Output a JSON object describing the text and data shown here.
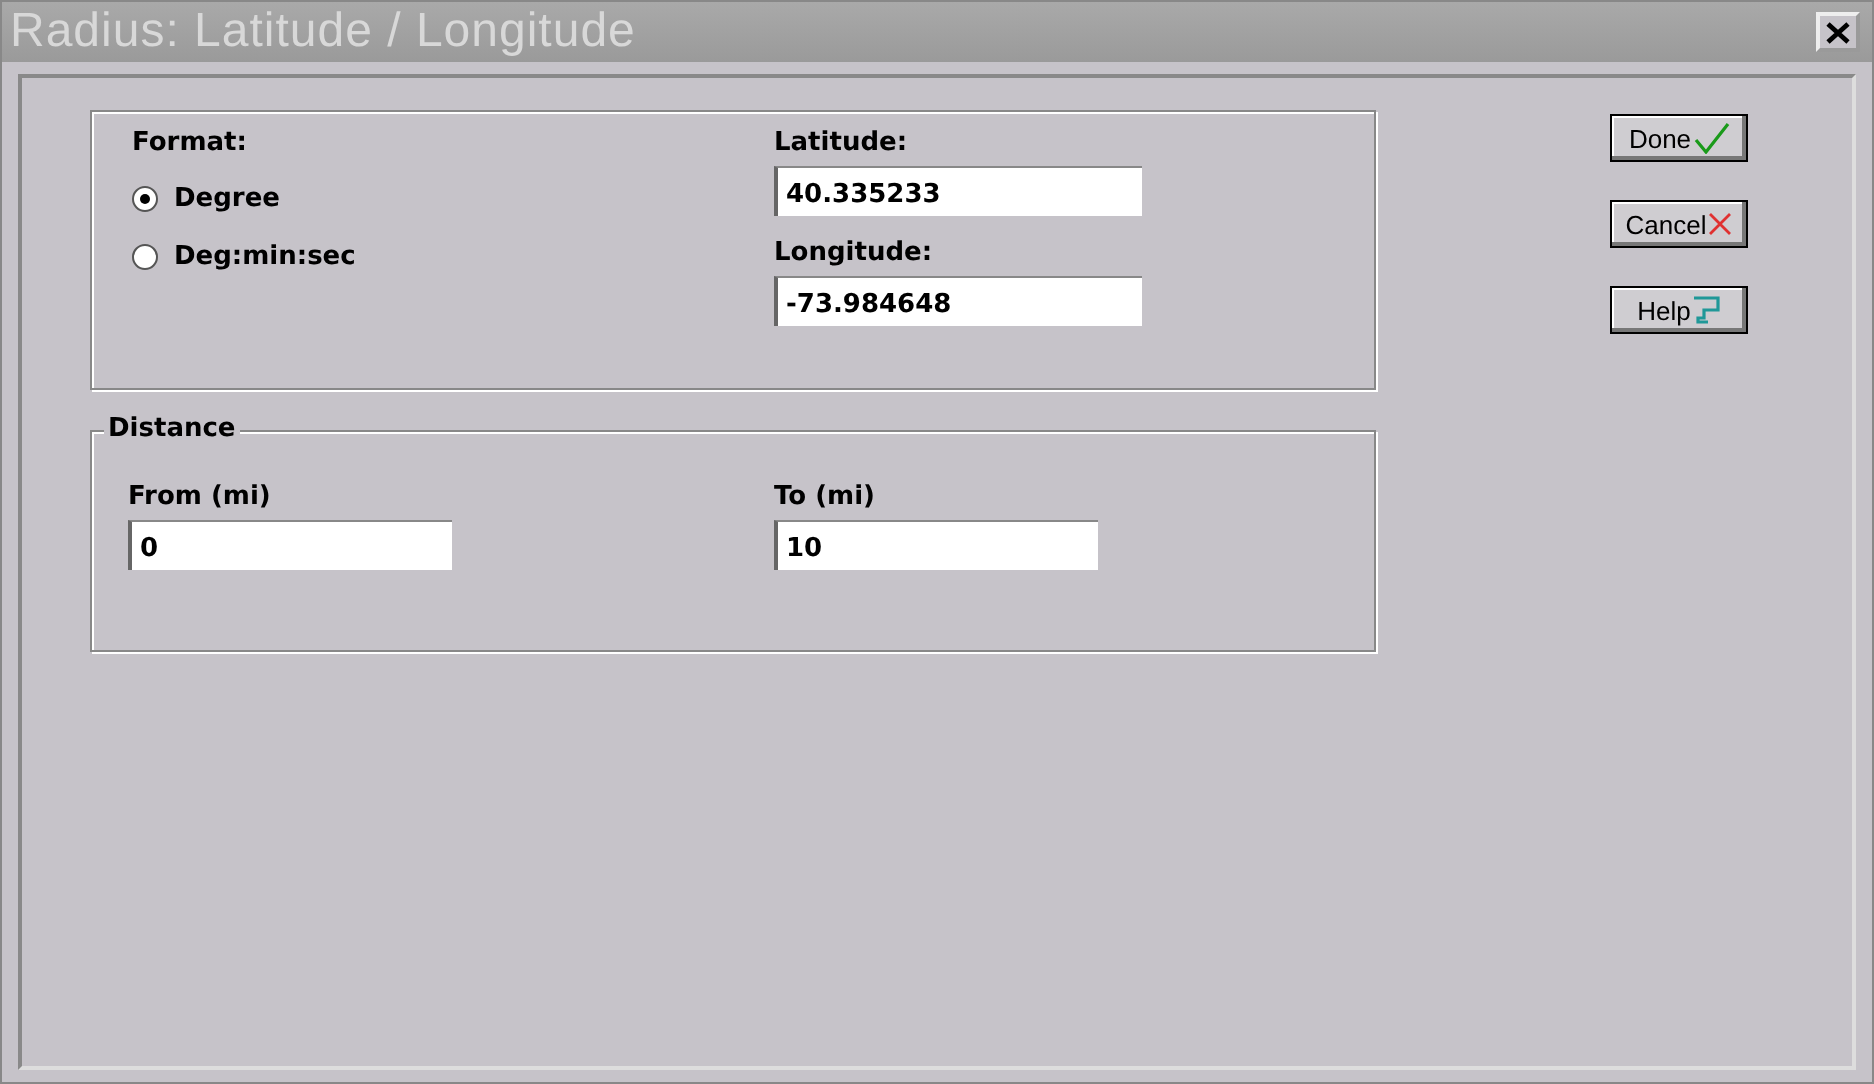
{
  "window": {
    "title": "Radius: Latitude / Longitude"
  },
  "format": {
    "label": "Format:",
    "options": [
      {
        "label": "Degree",
        "selected": true
      },
      {
        "label": "Deg:min:sec",
        "selected": false
      }
    ]
  },
  "latitude": {
    "label": "Latitude:",
    "value": "40.335233"
  },
  "longitude": {
    "label": "Longitude:",
    "value": "-73.984648"
  },
  "distance": {
    "title": "Distance",
    "from": {
      "label": "From (mi)",
      "value": "0"
    },
    "to": {
      "label": "To (mi)",
      "value": "10"
    }
  },
  "buttons": [
    {
      "label": "Done",
      "kind": "done"
    },
    {
      "label": "Cancel",
      "kind": "cancel"
    },
    {
      "label": "Help",
      "kind": "help"
    }
  ]
}
